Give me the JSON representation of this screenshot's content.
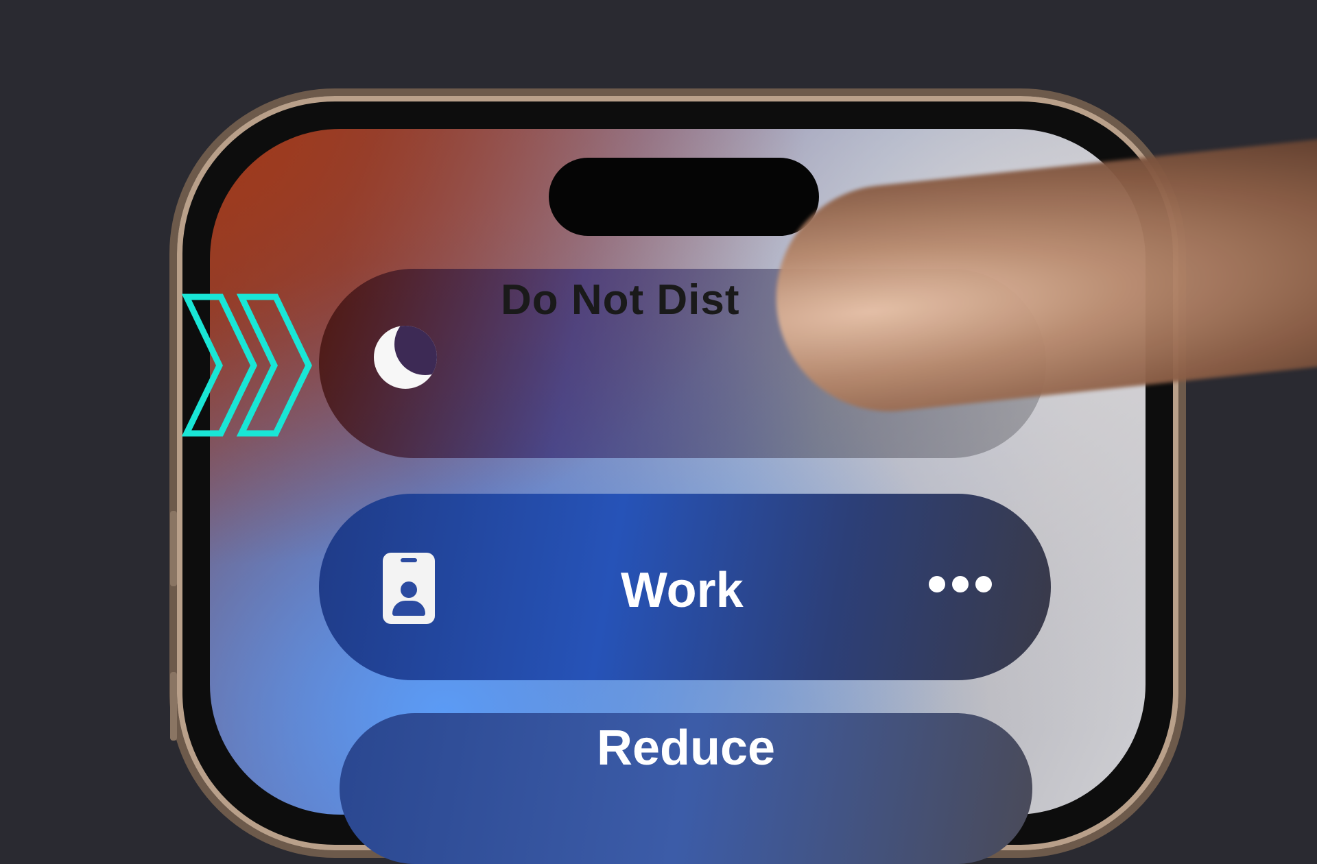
{
  "focus_modes": {
    "do_not_disturb": {
      "label": "Do Not Dist",
      "icon": "moon-icon"
    },
    "work": {
      "label": "Work",
      "icon": "id-badge-icon",
      "more": "ellipsis-icon"
    },
    "reduce": {
      "label": "Reduce"
    }
  },
  "overlay": {
    "icon": "double-chevron-right-icon",
    "color": "#19e6d6"
  },
  "colors": {
    "background": "#2a2a31",
    "work_pill": "#2653b8"
  }
}
